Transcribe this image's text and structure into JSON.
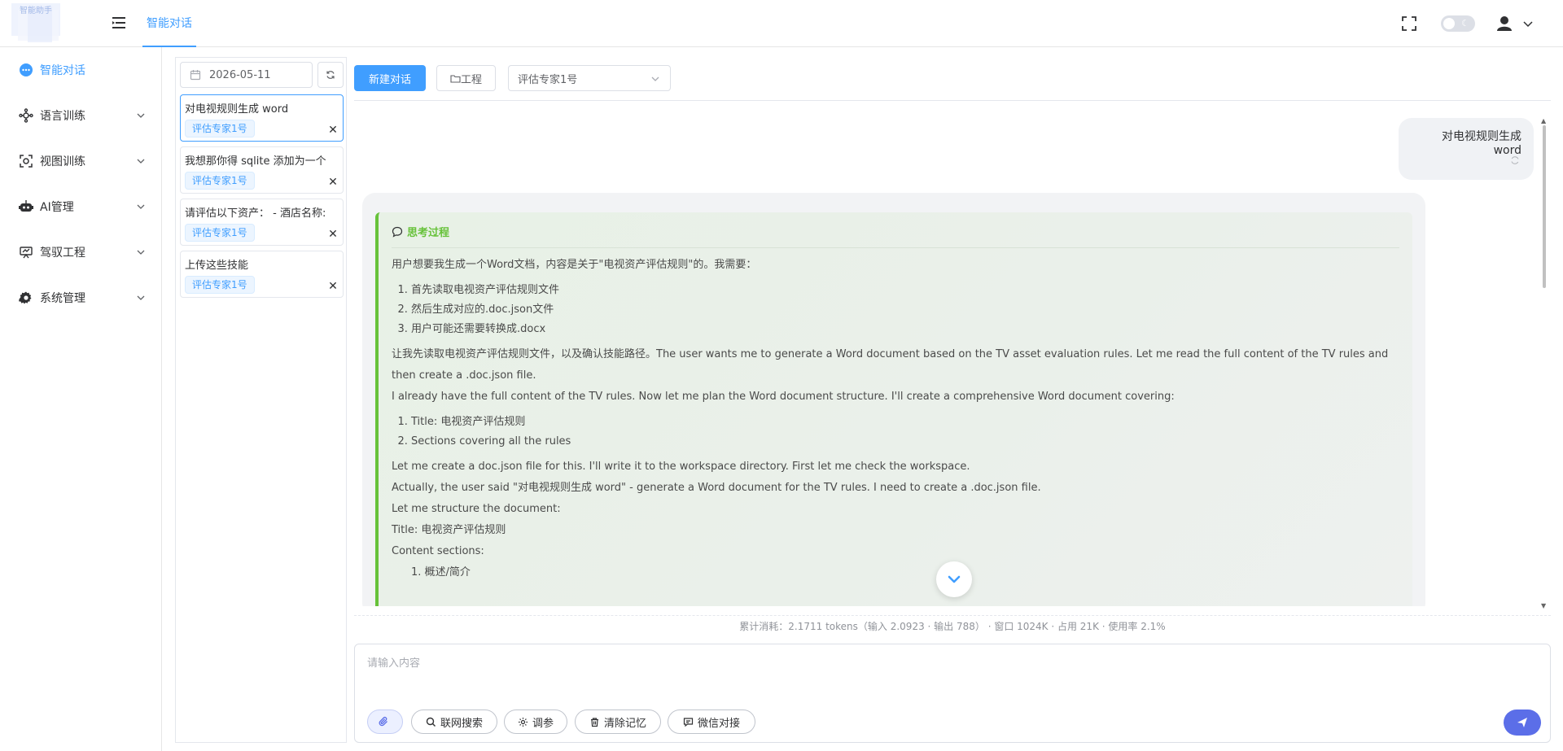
{
  "header": {
    "logo_text": "智能助手",
    "active_tab": "智能对话"
  },
  "sidebar": {
    "items": [
      {
        "label": "智能对话",
        "icon": "chat-dots-icon",
        "active": true
      },
      {
        "label": "语言训练",
        "icon": "network-icon"
      },
      {
        "label": "视图训练",
        "icon": "scan-icon"
      },
      {
        "label": "AI管理",
        "icon": "robot-icon"
      },
      {
        "label": "驾驭工程",
        "icon": "presentation-icon"
      },
      {
        "label": "系统管理",
        "icon": "gear-icon"
      }
    ]
  },
  "conversations": {
    "date": "2026-05-11",
    "items": [
      {
        "title": "对电视规则生成 word",
        "tag": "评估专家1号",
        "active": true
      },
      {
        "title": "我想那你得 sqlite 添加为一个",
        "tag": "评估专家1号"
      },
      {
        "title": "请评估以下资产： - 酒店名称:",
        "tag": "评估专家1号"
      },
      {
        "title": "上传这些技能",
        "tag": "评估专家1号"
      }
    ]
  },
  "toolbar": {
    "new_chat_label": "新建对话",
    "project_label": "工程",
    "expert_selected": "评估专家1号"
  },
  "messages": {
    "user_text": "对电视规则生成 word",
    "thinking": {
      "title": "思考过程",
      "intro": "用户想要我生成一个Word文档，内容是关于\"电视资产评估规则\"的。我需要：",
      "steps": [
        "首先读取电视资产评估规则文件",
        "然后生成对应的.doc.json文件",
        "用户可能还需要转换成.docx"
      ],
      "para1": "让我先读取电视资产评估规则文件，以及确认技能路径。The user wants me to generate a Word document based on the TV asset evaluation rules. Let me read the full content of the TV rules and then create a .doc.json file.",
      "para2": "I already have the full content of the TV rules. Now let me plan the Word document structure. I'll create a comprehensive Word document covering:",
      "plan": [
        "Title: 电视资产评估规则",
        "Sections covering all the rules"
      ],
      "line1": "Let me create a doc.json file for this. I'll write it to the workspace directory. First let me check the workspace.",
      "line2": "Actually, the user said \"对电视规则生成 word\" - generate a Word document for the TV rules. I need to create a .doc.json file.",
      "line3": "Let me structure the document:",
      "line4": "Title: 电视资产评估规则",
      "line5": "Content sections:",
      "line6": "1. 概述/简介"
    }
  },
  "usage": {
    "text": "累计消耗：2.1711 tokens（输入 2.0923 · 输出 788） · 窗口 1024K · 占用 21K · 使用率 2.1%"
  },
  "composer": {
    "placeholder": "请输入内容",
    "web_search_label": "联网搜索",
    "tune_label": "调参",
    "clear_memory_label": "清除记忆",
    "wechat_label": "微信对接"
  },
  "colors": {
    "primary": "#409eff",
    "think_accent": "#67c23a",
    "send": "#5b6ee8"
  }
}
